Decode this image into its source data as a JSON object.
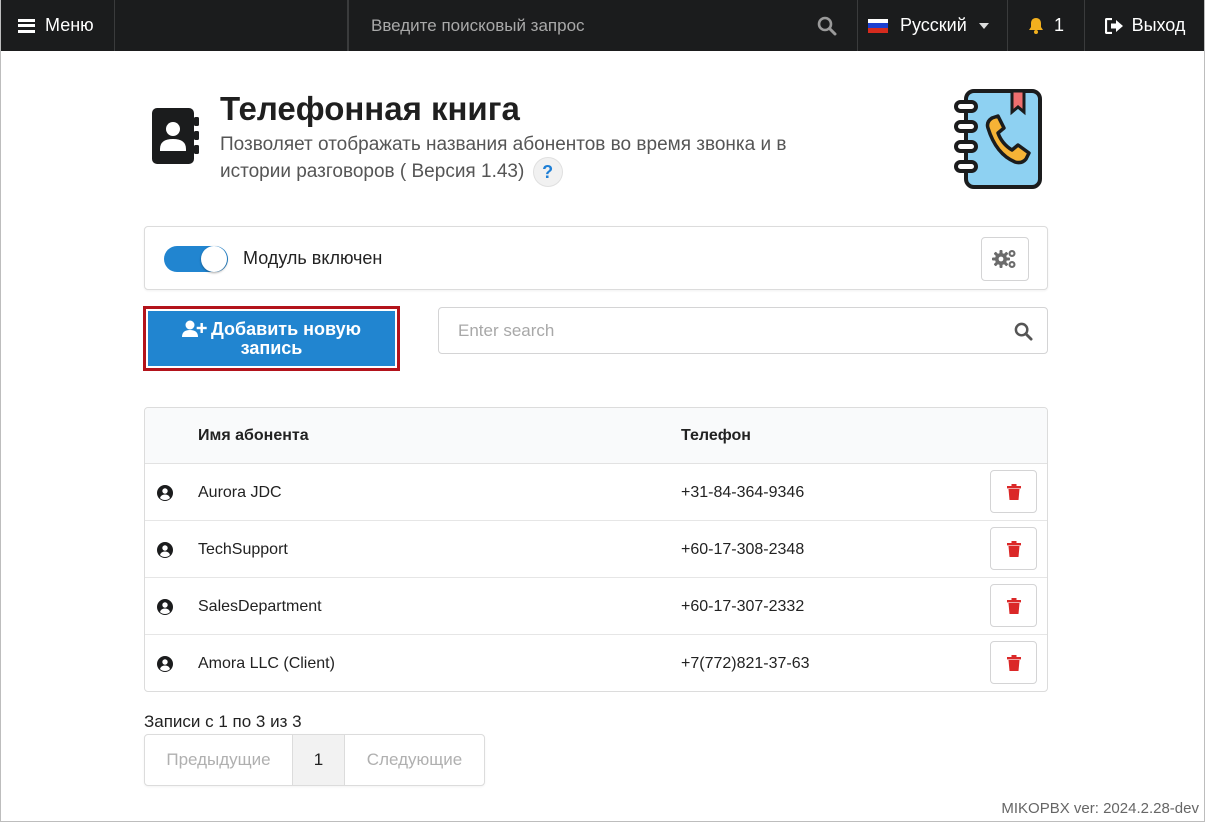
{
  "topbar": {
    "menu_label": "Меню",
    "search_placeholder": "Введите поисковый запрос",
    "language": "Русский",
    "notifications_count": "1",
    "exit_label": "Выход"
  },
  "header": {
    "title": "Телефонная книга",
    "subtitle": "Позволяет отображать названия абонентов во время звонка и в истории разговоров ( Версия 1.43)",
    "help": "?"
  },
  "module": {
    "status_label": "Модуль включен",
    "enabled": true
  },
  "toolbar": {
    "add_label_line1": "Добавить новую",
    "add_label_line2": "запись",
    "search_placeholder": "Enter search"
  },
  "table": {
    "columns": [
      "Имя абонента",
      "Телефон"
    ],
    "rows": [
      {
        "name": "Aurora JDC",
        "phone": "+31-84-364-9346"
      },
      {
        "name": "TechSupport",
        "phone": "+60-17-308-2348"
      },
      {
        "name": "SalesDepartment",
        "phone": "+60-17-307-2332"
      },
      {
        "name": "Amora LLC (Client)",
        "phone": "+7(772)821-37-63"
      }
    ]
  },
  "pagination": {
    "info": "Записи с 1 по 3 из 3",
    "prev": "Предыдущие",
    "current": "1",
    "next": "Следующие"
  },
  "footer": {
    "version": "MIKOPBX ver: 2024.2.28-dev"
  },
  "colors": {
    "topbar": "#1b1c1d",
    "primary": "#2185d0",
    "danger": "#db2828",
    "highlight_outline": "#b3131b"
  }
}
